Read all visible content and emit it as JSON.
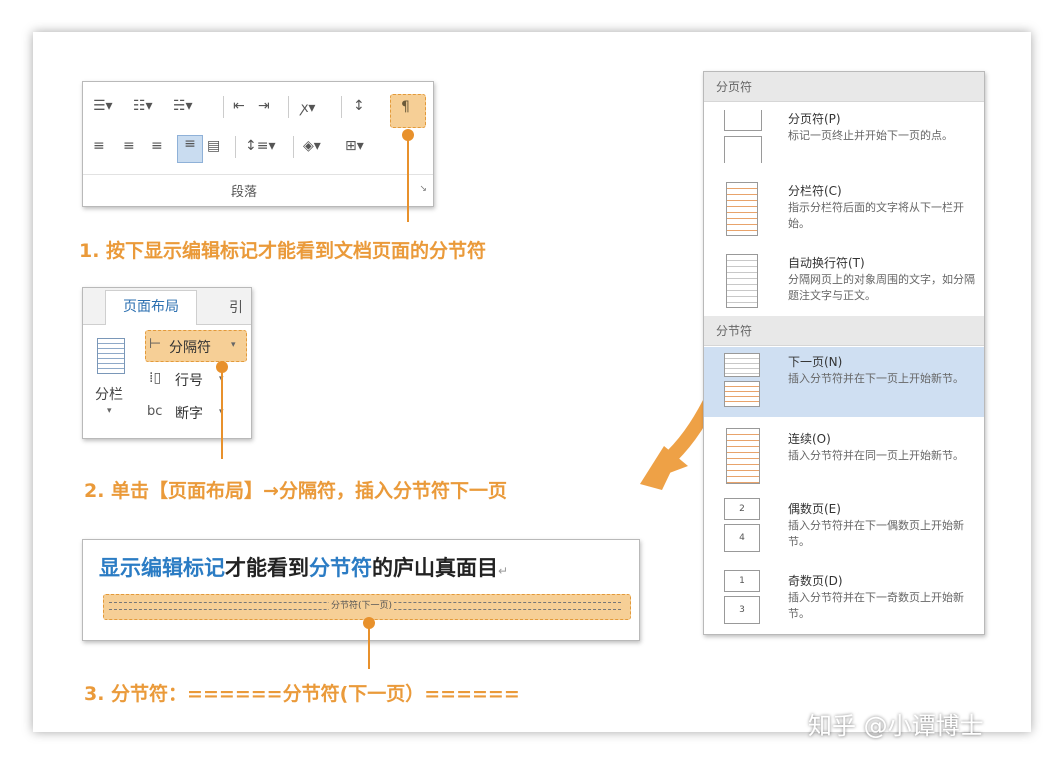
{
  "ribbon1": {
    "group_label": "段落"
  },
  "ribbon2": {
    "tab_active": "页面布局",
    "tab_next": "引",
    "columns_label": "分栏",
    "breaks_label": "分隔符",
    "line_numbers_label": "行号",
    "hyphenation_label": "断字"
  },
  "steps": {
    "step1": "1. 按下显示编辑标记才能看到文档页面的分节符",
    "step2": "2. 单击【页面布局】→分隔符，插入分节符下一页",
    "step3": "3. 分节符：======分节符(下一页）======"
  },
  "doc_sample": {
    "part1": "显示编辑标记",
    "part2": "才能看到",
    "part3": "分节符",
    "part4": "的庐山真面目",
    "section_break_label": "分节符(下一页)"
  },
  "menu": {
    "header_page_breaks": "分页符",
    "header_section_breaks": "分节符",
    "items": [
      {
        "title": "分页符(P)",
        "desc": "标记一页终止并开始下一页的点。"
      },
      {
        "title": "分栏符(C)",
        "desc": "指示分栏符后面的文字将从下一栏开始。"
      },
      {
        "title": "自动换行符(T)",
        "desc": "分隔网页上的对象周围的文字，如分隔题注文字与正文。"
      },
      {
        "title": "下一页(N)",
        "desc": "插入分节符并在下一页上开始新节。"
      },
      {
        "title": "连续(O)",
        "desc": "插入分节符并在同一页上开始新节。"
      },
      {
        "title": "偶数页(E)",
        "desc": "插入分节符并在下一偶数页上开始新节。"
      },
      {
        "title": "奇数页(D)",
        "desc": "插入分节符并在下一奇数页上开始新节。"
      }
    ]
  },
  "watermark": "知乎 @小谭博士",
  "colors": {
    "accent": "#e8912c",
    "highlight_blue": "#2b7cc4",
    "selected_row": "#cfdff2"
  }
}
